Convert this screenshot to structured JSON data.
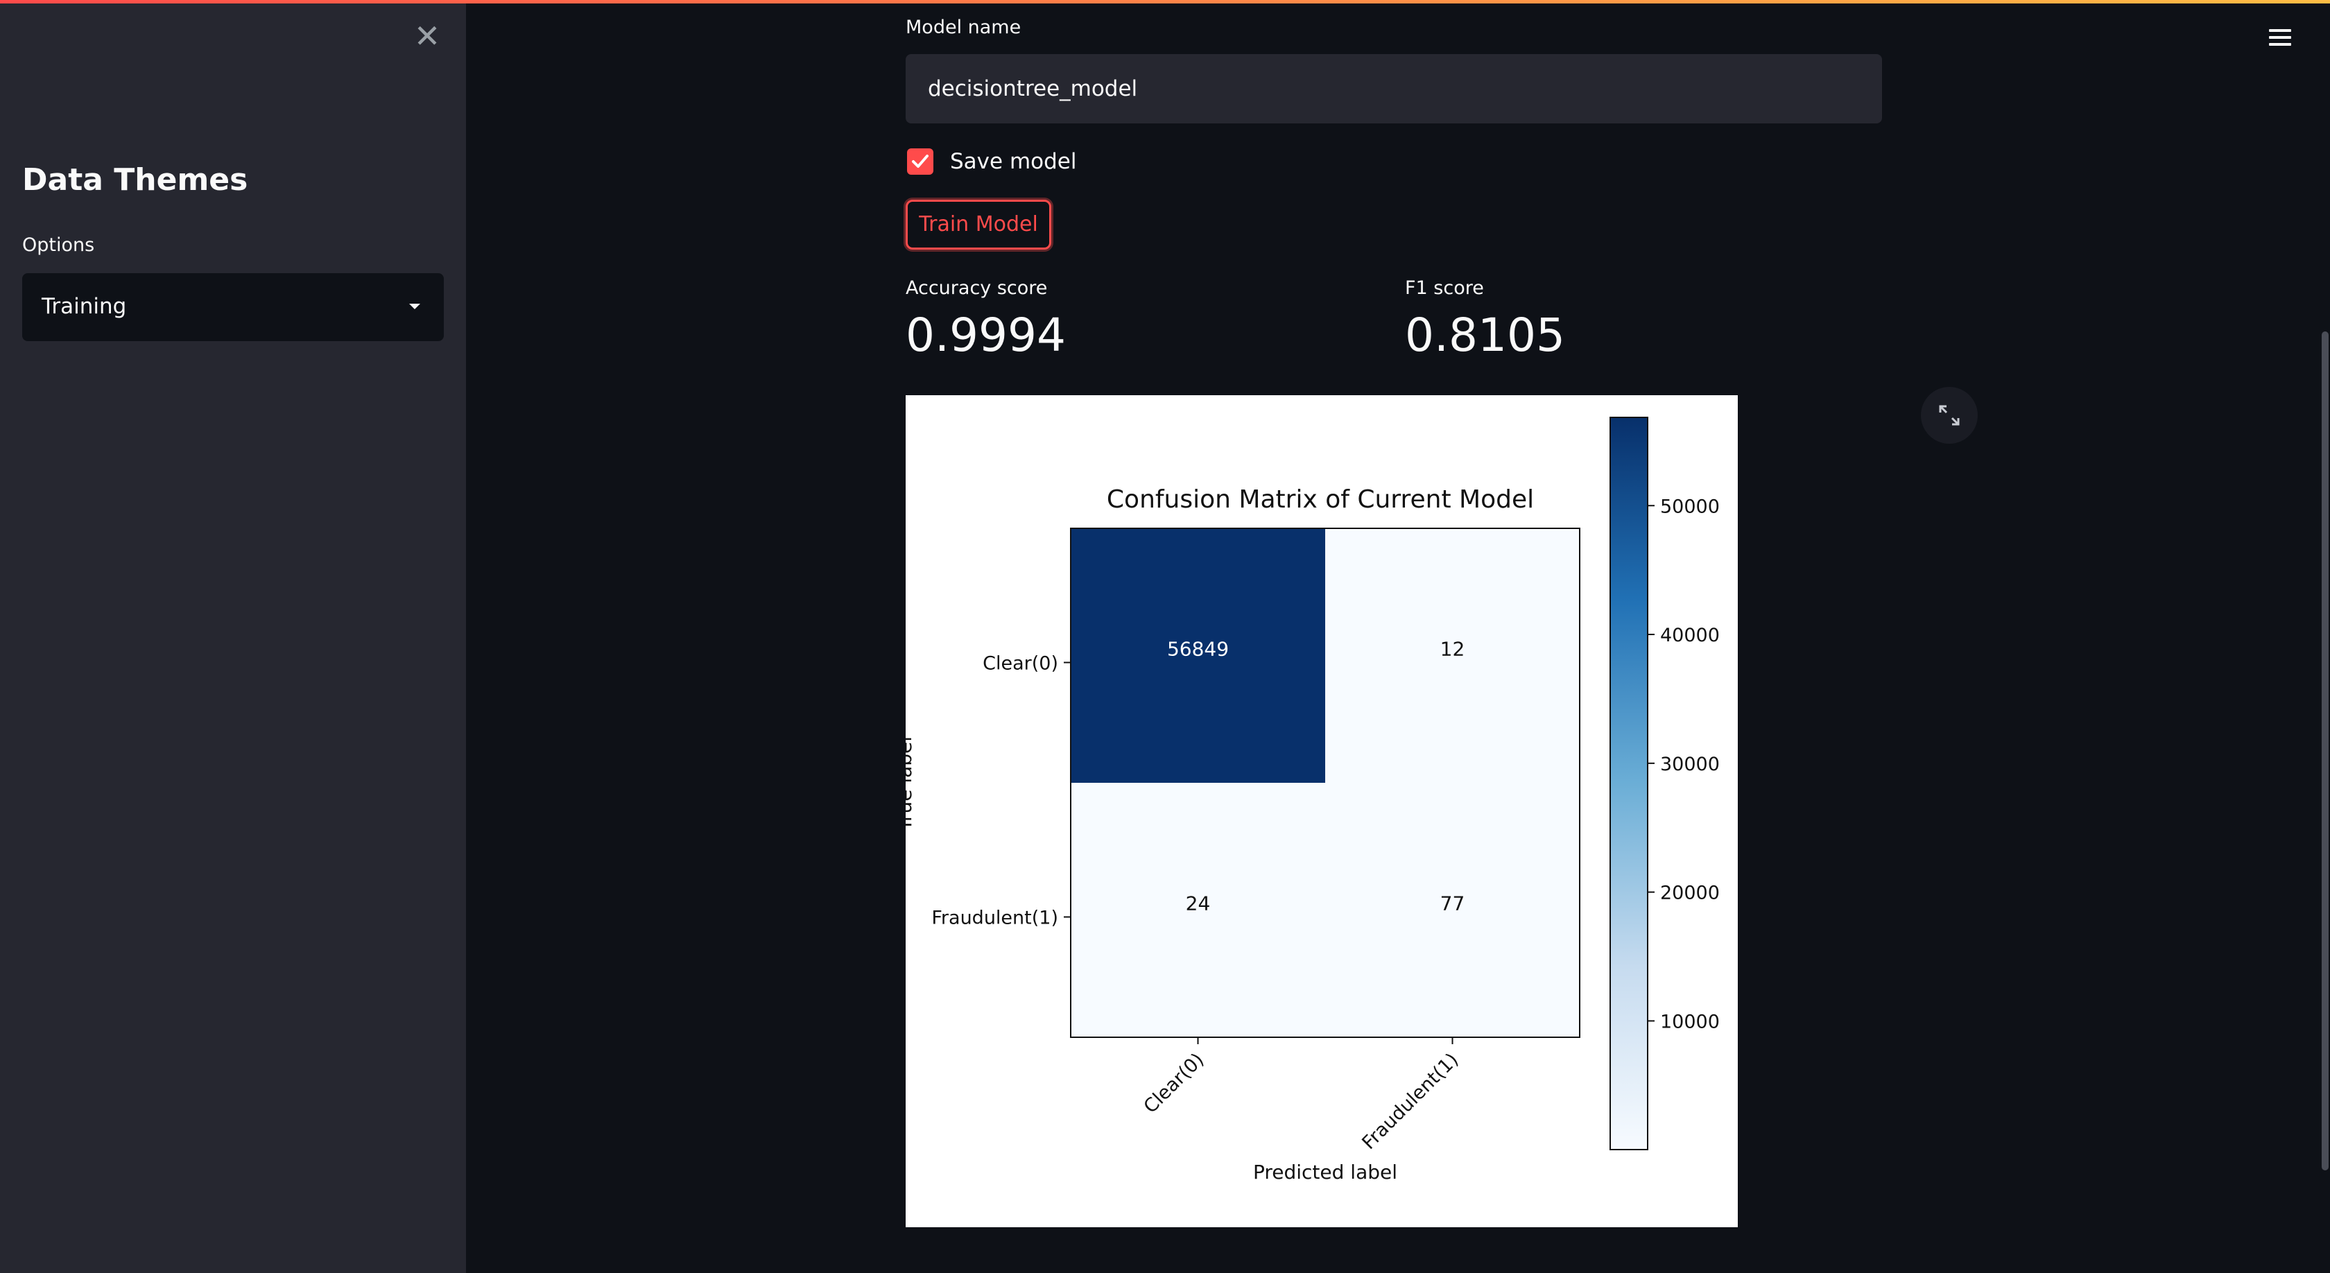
{
  "sidebar": {
    "title": "Data Themes",
    "options_label": "Options",
    "selected_option": "Training"
  },
  "form": {
    "model_name_label": "Model name",
    "model_name_value": "decisiontree_model",
    "save_model_label": "Save model",
    "save_model_checked": true,
    "train_button_label": "Train Model"
  },
  "metrics": {
    "accuracy_label": "Accuracy score",
    "accuracy_value": "0.9994",
    "f1_label": "F1 score",
    "f1_value": "0.8105"
  },
  "colors": {
    "accent": "#ff4b4b",
    "background": "#0e1117",
    "sidebar": "#262730"
  },
  "chart_data": {
    "type": "heatmap",
    "title": "Confusion Matrix of Current Model",
    "xlabel": "Predicted label",
    "ylabel": "True label",
    "x_categories": [
      "Clear(0)",
      "Fraudulent(1)"
    ],
    "y_categories": [
      "Clear(0)",
      "Fraudulent(1)"
    ],
    "values": [
      [
        56849,
        12
      ],
      [
        24,
        77
      ]
    ],
    "colormap": "Blues",
    "colorbar_ticks": [
      "10000",
      "20000",
      "30000",
      "40000",
      "50000"
    ],
    "colorbar_range": [
      12,
      56849
    ]
  }
}
